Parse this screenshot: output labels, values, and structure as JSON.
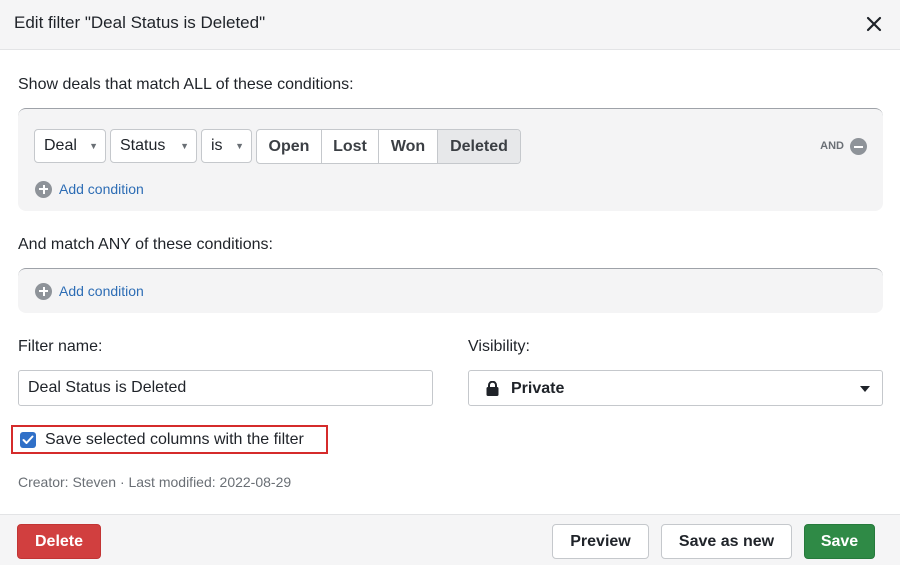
{
  "header": {
    "title": "Edit filter \"Deal Status is Deleted\""
  },
  "all_conditions": {
    "label": "Show deals that match ALL of these conditions:",
    "condition": {
      "object": "Deal",
      "field": "Status",
      "operator": "is",
      "options": [
        "Open",
        "Lost",
        "Won",
        "Deleted"
      ],
      "selected": "Deleted"
    },
    "connector": "AND",
    "add_label": "Add condition"
  },
  "any_conditions": {
    "label": "And match ANY of these conditions:",
    "add_label": "Add condition"
  },
  "filter_name": {
    "label": "Filter name:",
    "value": "Deal Status is Deleted"
  },
  "visibility": {
    "label": "Visibility:",
    "value": "Private",
    "icon": "lock-icon"
  },
  "save_columns": {
    "label": "Save selected columns with the filter",
    "checked": true
  },
  "meta": "Creator: Steven · Last modified: 2022-08-29",
  "footer": {
    "delete": "Delete",
    "preview": "Preview",
    "save_as_new": "Save as new",
    "save": "Save"
  },
  "colors": {
    "accent_blue": "#3070c8",
    "link_blue": "#2d6db5",
    "delete_red": "#d13f3f",
    "save_green": "#2f8a46",
    "highlight_red": "#d52b2b"
  }
}
